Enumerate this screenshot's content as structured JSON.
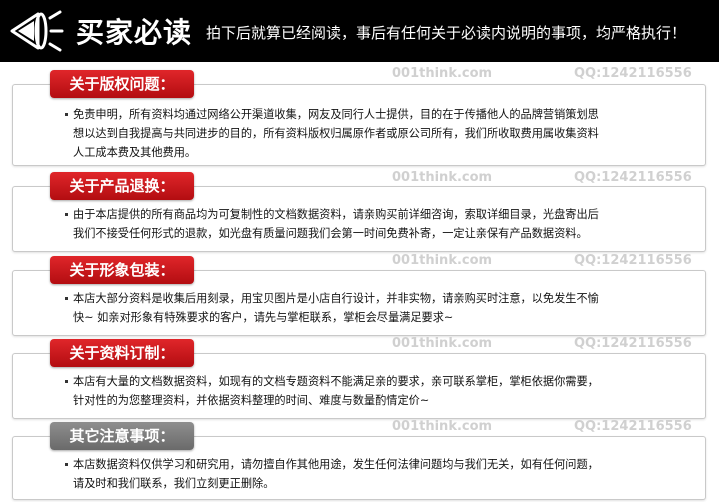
{
  "header": {
    "title": "买家必读",
    "subtitle": "拍下后就算已经阅读，事后有任何关于必读内说明的事项，均严格执行！",
    "icon": "megaphone-icon"
  },
  "watermark": {
    "site": "001think.com",
    "qq": "QQ:1242116556"
  },
  "sections": [
    {
      "tag": "关于版权问题：",
      "lines": [
        "免责申明，所有资料均通过网络公开渠道收集，网友及同行人士提供，目的在于传播他人的品牌营销策划思",
        "想以达到自我提高与共同进步的目的，所有资料版权归属原作者或原公司所有，我们所收取费用属收集资料",
        "人工成本费及其他费用。"
      ]
    },
    {
      "tag": "关于产品退换：",
      "lines": [
        "由于本店提供的所有商品均为可复制性的文档数据资料，请亲购买前详细咨询，索取详细目录，光盘寄出后",
        "我们不接受任何形式的退款，如光盘有质量问题我们会第一时间免费补寄，一定让亲保有产品数据资料。"
      ]
    },
    {
      "tag": "关于形象包装：",
      "lines": [
        "本店大部分资料是收集后用刻录，用宝贝图片是小店自行设计，并非实物，请亲购买时注意，以免发生不愉",
        "快~ 如亲对形象有特殊要求的客户，请先与掌柜联系，掌柜会尽量满足要求~"
      ]
    },
    {
      "tag": "关于资料订制：",
      "lines": [
        "本店有大量的文档数据资料，如现有的文档专题资料不能满足亲的要求，亲可联系掌柜，掌柜依据你需要，",
        "针对性的为您整理资料，并依据资料整理的时间、难度与数量酌情定价~"
      ]
    },
    {
      "tag": "其它注意事项：",
      "lines": [
        "本店数据资料仅供学习和研究用，请勿擅自作其他用途，发生任何法律问题均与我们无关，如有任何问题，",
        "请及时和我们联系，我们立刻更正删除。"
      ]
    }
  ],
  "colors": {
    "tag_red": "#c41a1e",
    "tag_gray": "#7a7a7a",
    "header_bg": "#000000"
  }
}
